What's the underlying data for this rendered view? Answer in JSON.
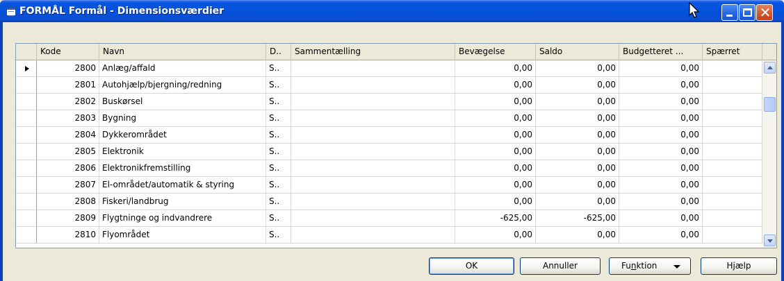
{
  "window": {
    "title": "FORMÅL Formål - Dimensionsværdier"
  },
  "columns": [
    "Kode",
    "Navn",
    "D..",
    "Sammentælling",
    "Bevægelse",
    "Saldo",
    "Budgetteret ...",
    "Spærret"
  ],
  "rows": [
    {
      "kode": "2800",
      "navn": "Anlæg/affald",
      "d": "S..",
      "sum": "",
      "bevaegelse": "0,00",
      "saldo": "0,00",
      "budget": "0,00",
      "spaerret": "",
      "current": true
    },
    {
      "kode": "2801",
      "navn": "Autohjælp/bjergning/redning",
      "d": "S..",
      "sum": "",
      "bevaegelse": "0,00",
      "saldo": "0,00",
      "budget": "0,00",
      "spaerret": ""
    },
    {
      "kode": "2802",
      "navn": "Buskørsel",
      "d": "S..",
      "sum": "",
      "bevaegelse": "0,00",
      "saldo": "0,00",
      "budget": "0,00",
      "spaerret": ""
    },
    {
      "kode": "2803",
      "navn": "Bygning",
      "d": "S..",
      "sum": "",
      "bevaegelse": "0,00",
      "saldo": "0,00",
      "budget": "0,00",
      "spaerret": ""
    },
    {
      "kode": "2804",
      "navn": "Dykkerområdet",
      "d": "S..",
      "sum": "",
      "bevaegelse": "0,00",
      "saldo": "0,00",
      "budget": "0,00",
      "spaerret": ""
    },
    {
      "kode": "2805",
      "navn": "Elektronik",
      "d": "S..",
      "sum": "",
      "bevaegelse": "0,00",
      "saldo": "0,00",
      "budget": "0,00",
      "spaerret": ""
    },
    {
      "kode": "2806",
      "navn": "Elektronikfremstilling",
      "d": "S..",
      "sum": "",
      "bevaegelse": "0,00",
      "saldo": "0,00",
      "budget": "0,00",
      "spaerret": ""
    },
    {
      "kode": "2807",
      "navn": "El-området/automatik & styring",
      "d": "S..",
      "sum": "",
      "bevaegelse": "0,00",
      "saldo": "0,00",
      "budget": "0,00",
      "spaerret": ""
    },
    {
      "kode": "2808",
      "navn": "Fiskeri/landbrug",
      "d": "S..",
      "sum": "",
      "bevaegelse": "0,00",
      "saldo": "0,00",
      "budget": "0,00",
      "spaerret": ""
    },
    {
      "kode": "2809",
      "navn": "Flygtninge og indvandrere",
      "d": "S..",
      "sum": "",
      "bevaegelse": "-625,00",
      "saldo": "-625,00",
      "budget": "0,00",
      "spaerret": ""
    },
    {
      "kode": "2810",
      "navn": "Flyområdet",
      "d": "S..",
      "sum": "",
      "bevaegelse": "0,00",
      "saldo": "0,00",
      "budget": "0,00",
      "spaerret": ""
    }
  ],
  "buttons": {
    "ok": "OK",
    "annuller": "Annuller",
    "funktion_prefix": "Fu",
    "funktion_underlined": "n",
    "funktion_suffix": "ktion",
    "hjaelp": "Hjælp"
  },
  "icons": {
    "window": "table-icon",
    "minimize": "minimize-icon",
    "maximize": "maximize-icon",
    "close": "close-icon",
    "cursor": "mouse-pointer-icon"
  },
  "colors": {
    "titlebar": "#0351da",
    "close_button": "#d2562e",
    "window_bg": "#ece9d8"
  }
}
